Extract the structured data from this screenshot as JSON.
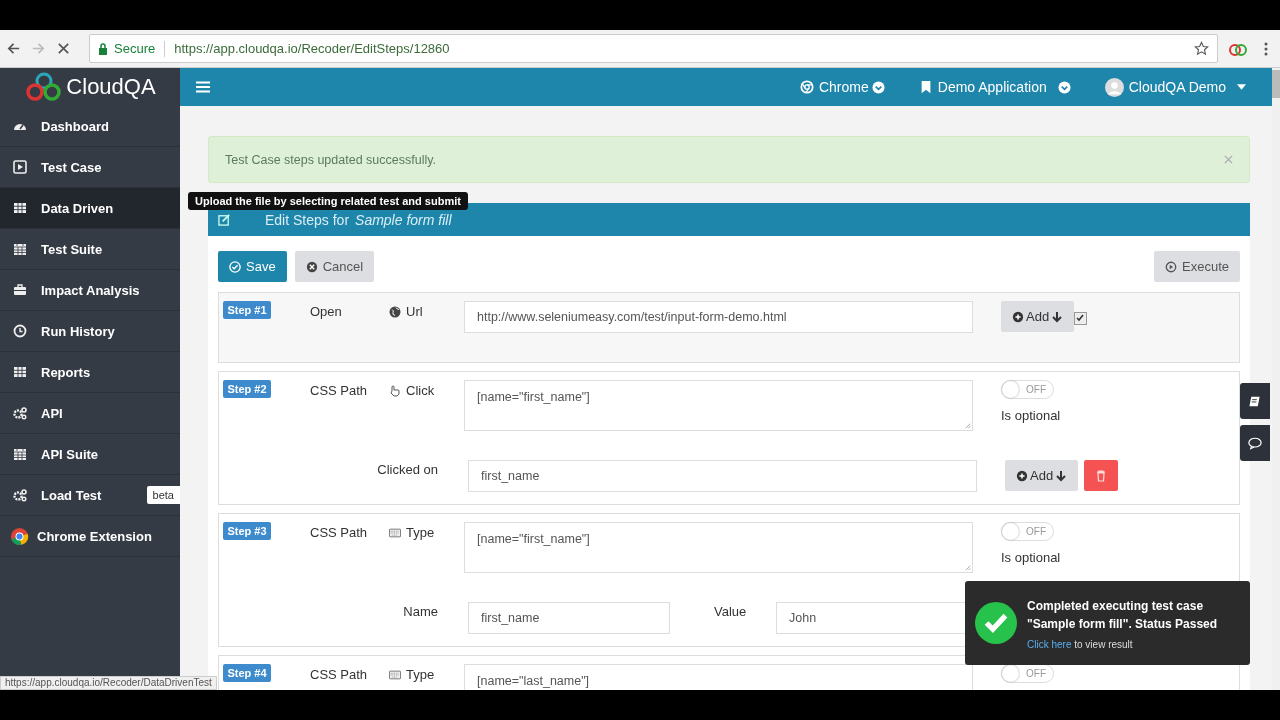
{
  "browser": {
    "secure_label": "Secure",
    "url": "https://app.cloudqa.io/Recoder/EditSteps/12860",
    "status_url": "https://app.cloudqa.io/Recoder/DataDrivenTest"
  },
  "brand": "CloudQA",
  "header": {
    "browser": "Chrome",
    "application": "Demo Application",
    "user": "CloudQA Demo"
  },
  "sidebar": {
    "items": [
      {
        "label": "Dashboard",
        "selected": false
      },
      {
        "label": "Test Case",
        "selected": false
      },
      {
        "label": "Data Driven",
        "selected": true
      },
      {
        "label": "Test Suite",
        "selected": false
      },
      {
        "label": "Impact Analysis",
        "selected": false
      },
      {
        "label": "Run History",
        "selected": false
      },
      {
        "label": "Reports",
        "selected": false
      },
      {
        "label": "API",
        "selected": false
      },
      {
        "label": "API Suite",
        "selected": false
      },
      {
        "label": "Load Test",
        "selected": false,
        "badge": "beta"
      },
      {
        "label": "Chrome Extension",
        "selected": false
      }
    ]
  },
  "tooltip": "Upload the file by selecting related test and submit",
  "alert": "Test Case steps updated successfully.",
  "panel": {
    "title": "Edit Steps for",
    "test_name": "Sample form fill",
    "save": "Save",
    "cancel": "Cancel",
    "execute": "Execute"
  },
  "steps": [
    {
      "kind": "open",
      "badge": "Step #1",
      "locator": "Open",
      "action": "Url",
      "target": "http://www.seleniumeasy.com/test/input-form-demo.html",
      "add_label": "Add",
      "checked": true
    },
    {
      "kind": "click",
      "badge": "Step #2",
      "locator": "CSS Path",
      "action": "Click",
      "target": "[name=\"first_name\"]",
      "optional": false,
      "toggle_label": "OFF",
      "optional_label": "Is optional",
      "detail_label": "Clicked on",
      "detail_value": "first_name",
      "add_label": "Add"
    },
    {
      "kind": "type",
      "badge": "Step #3",
      "locator": "CSS Path",
      "action": "Type",
      "target": "[name=\"first_name\"]",
      "optional": false,
      "toggle_label": "OFF",
      "optional_label": "Is optional",
      "name_label": "Name",
      "name_value": "first_name",
      "value_label": "Value",
      "value_value": "John"
    },
    {
      "kind": "type",
      "badge": "Step #4",
      "locator": "CSS Path",
      "action": "Type",
      "target": "[name=\"last_name\"]",
      "optional": false,
      "toggle_label": "OFF"
    }
  ],
  "toast": {
    "message": "Completed executing test case \"Sample form fill\". Status Passed",
    "link": "Click here",
    "suffix": "to view result"
  }
}
